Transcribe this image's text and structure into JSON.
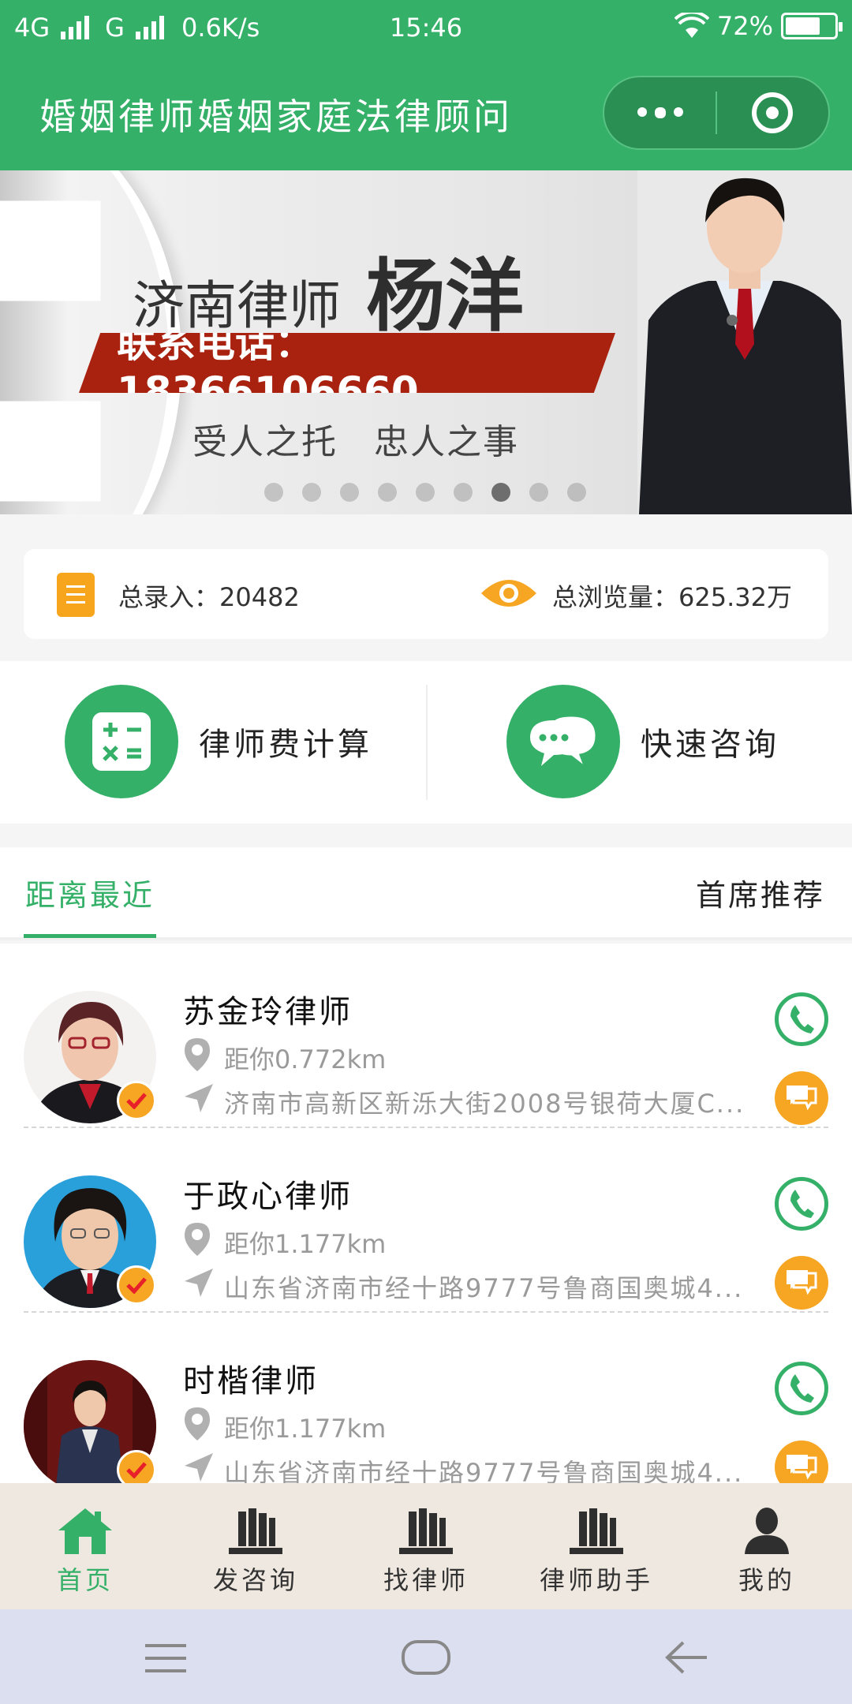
{
  "status_bar": {
    "network1": "4G",
    "network2": "G",
    "speed": "0.6K/s",
    "time": "15:46",
    "battery": "72%",
    "battery_level": 0.72
  },
  "header": {
    "title": "婚姻律师婚姻家庭法律顾问",
    "more_icon": "more-dots-icon",
    "close_icon": "target-circle-icon"
  },
  "banner": {
    "city_title": "济南律师",
    "lawyer_name": "杨洋",
    "phone_line": "联系电话：18366106660",
    "slogan": "受人之托　忠人之事",
    "slide_count": 9,
    "active_slide": 7
  },
  "stats": {
    "entries_label": "总录入：20482",
    "views_label": "总浏览量：625.32万"
  },
  "quick_actions": [
    {
      "label": "律师费计算",
      "icon": "calculator-icon"
    },
    {
      "label": "快速咨询",
      "icon": "chat-bubbles-icon"
    }
  ],
  "tabs": {
    "active": "距离最近",
    "other": "首席推荐"
  },
  "lawyers": [
    {
      "name": "苏金玲律师",
      "distance": "距你0.772km",
      "address": "济南市高新区新泺大街2008号银荷大厦C..."
    },
    {
      "name": "于政心律师",
      "distance": "距你1.177km",
      "address": "山东省济南市经十路9777号鲁商国奥城4..."
    },
    {
      "name": "时楷律师",
      "distance": "距你1.177km",
      "address": "山东省济南市经十路9777号鲁商国奥城4..."
    }
  ],
  "bottom_nav": [
    {
      "label": "首页",
      "icon": "home-icon"
    },
    {
      "label": "发咨询",
      "icon": "books-icon"
    },
    {
      "label": "找律师",
      "icon": "books-icon"
    },
    {
      "label": "律师助手",
      "icon": "books-icon"
    },
    {
      "label": "我的",
      "icon": "user-icon"
    }
  ],
  "colors": {
    "brand_green": "#35b068",
    "accent_orange": "#f6a623",
    "banner_red": "#a9220f"
  }
}
